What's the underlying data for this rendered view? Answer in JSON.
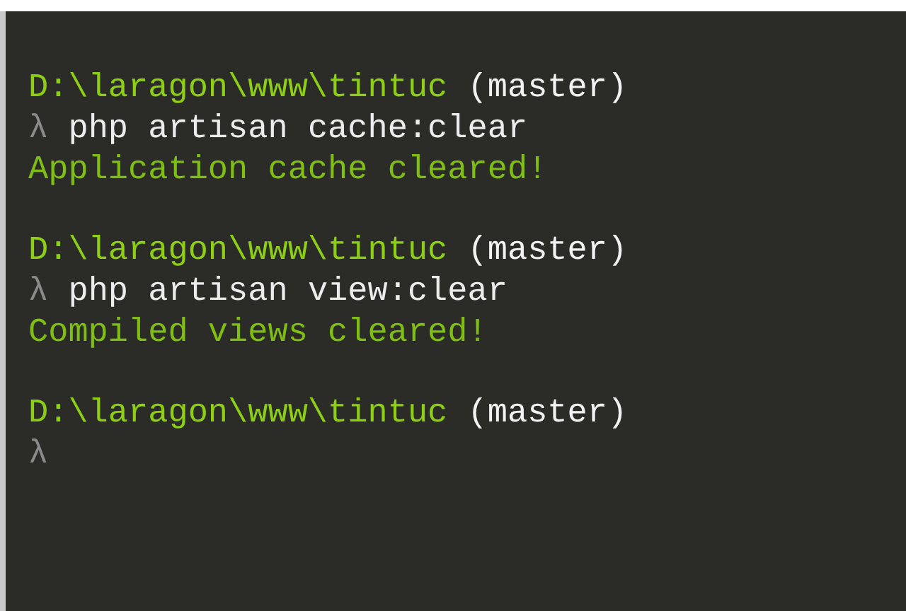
{
  "terminal": {
    "lines": [
      {
        "kind": "prompt",
        "path": "D:\\laragon\\www\\tintuc",
        "branch": "(master)"
      },
      {
        "kind": "command",
        "symbol": "λ",
        "text": "php artisan cache:clear"
      },
      {
        "kind": "output",
        "text": "Application cache cleared!"
      },
      {
        "kind": "blank"
      },
      {
        "kind": "prompt",
        "path": "D:\\laragon\\www\\tintuc",
        "branch": "(master)"
      },
      {
        "kind": "command",
        "symbol": "λ",
        "text": "php artisan view:clear"
      },
      {
        "kind": "output",
        "text": "Compiled views cleared!"
      },
      {
        "kind": "blank"
      },
      {
        "kind": "prompt",
        "path": "D:\\laragon\\www\\tintuc",
        "branch": "(master)"
      },
      {
        "kind": "command",
        "symbol": "λ"
      }
    ]
  }
}
